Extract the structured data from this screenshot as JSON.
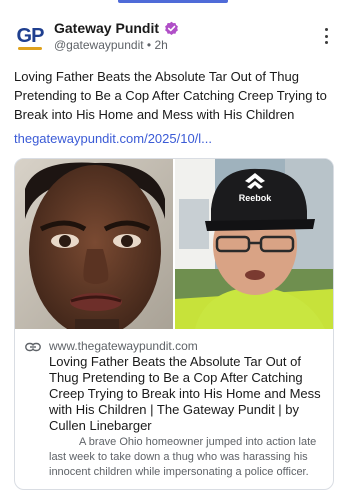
{
  "author": {
    "name": "Gateway Pundit",
    "handle": "@gatewaypundit",
    "time": "2h",
    "avatar_text": "GP"
  },
  "post": {
    "text": "Loving Father Beats the Absolute Tar Out of Thug Pretending to Be a Cop After Catching Creep Trying to Break into His Home and Mess with His Children",
    "link": "thegatewaypundit.com/2025/10/l..."
  },
  "card": {
    "domain": "www.thegatewaypundit.com",
    "title": "Loving Father Beats the Absolute Tar Out of Thug Pretending to Be a Cop After Catching Creep Trying to Break into His Home and Mess with His Children | The Gateway Pundit | by Cullen Linebarger",
    "description": "A brave Ohio homeowner jumped into action late last week to take down a thug who was harassing his innocent children while impersonating a police officer.",
    "hat_brand": "Reebok"
  },
  "colors": {
    "accent": "#4f6bd8",
    "link": "#3b5bd6",
    "verified": "#b04fc7"
  },
  "icons": {
    "verified": "verified-badge-icon",
    "more": "more-vertical-icon",
    "link": "link-icon"
  }
}
